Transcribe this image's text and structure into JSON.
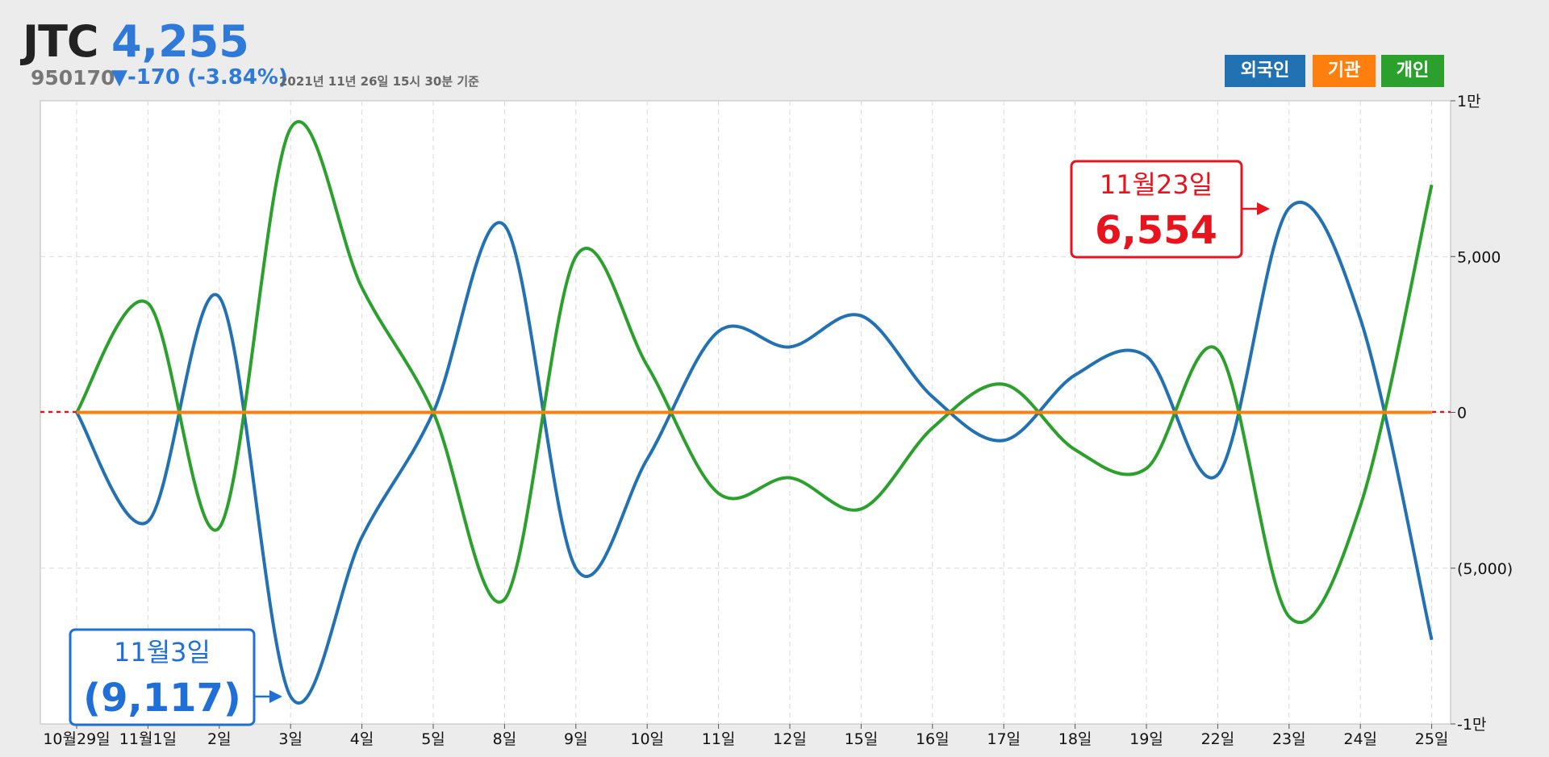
{
  "header": {
    "ticker": "JTC",
    "price": "4,255",
    "code": "950170",
    "change": "▼-170 (-3.84%)",
    "as_of": "2021년 11년 26일 15시 30분 기준"
  },
  "legend": [
    {
      "label": "외국인",
      "color": "#2271b3"
    },
    {
      "label": "기관",
      "color": "#ff7f0e"
    },
    {
      "label": "개인",
      "color": "#2ca02c"
    }
  ],
  "callouts": {
    "max": {
      "date": "11월23일",
      "value": "6,554",
      "color": "#e8141d"
    },
    "min": {
      "date": "11월3일",
      "value": "(9,117)",
      "color": "#1f6fd6"
    }
  },
  "chart_data": {
    "type": "line",
    "x": [
      "10월29일",
      "11월1일",
      "2일",
      "3일",
      "4일",
      "5일",
      "8일",
      "9일",
      "10일",
      "11일",
      "12일",
      "15일",
      "16일",
      "17일",
      "18일",
      "19일",
      "22일",
      "23일",
      "24일",
      "25일"
    ],
    "y_ticks": [
      "1만",
      "5,000",
      "0",
      "(5,000)",
      "-1만"
    ],
    "ylim": [
      -10000,
      10000
    ],
    "series": [
      {
        "name": "외국인",
        "color": "#2271b3",
        "values": [
          0,
          -3500,
          3700,
          -9117,
          -4000,
          0,
          6000,
          -5000,
          -1500,
          2600,
          2100,
          3100,
          500,
          -900,
          1200,
          1800,
          -2000,
          6554,
          3000,
          -7300
        ]
      },
      {
        "name": "기관",
        "color": "#ff7f0e",
        "values": [
          0,
          0,
          0,
          0,
          0,
          0,
          0,
          0,
          0,
          0,
          0,
          0,
          0,
          0,
          0,
          0,
          0,
          0,
          0,
          0
        ]
      },
      {
        "name": "개인",
        "color": "#2ca02c",
        "values": [
          0,
          3500,
          -3700,
          9117,
          4000,
          0,
          -6000,
          5000,
          1500,
          -2600,
          -2100,
          -3100,
          -500,
          900,
          -1200,
          -1800,
          2000,
          -6554,
          -3000,
          7300
        ]
      }
    ]
  }
}
